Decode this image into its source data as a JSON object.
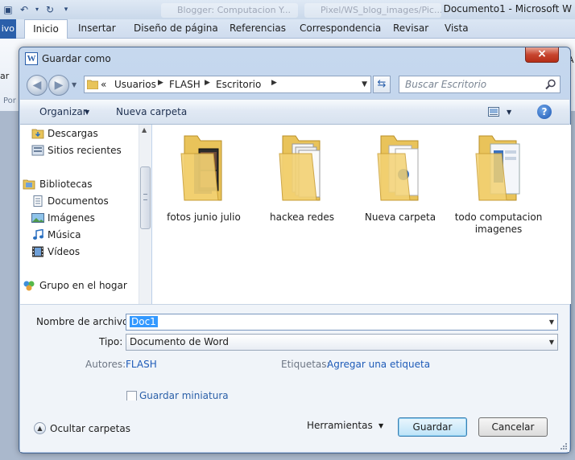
{
  "word": {
    "title": "Documento1 - Microsoft W",
    "browser_tabs": [
      "Blogger: Computacion Y...",
      "Pixel/WS_blog_images/Pic..."
    ],
    "archivo_tab": "ivo",
    "ribbon_tabs": [
      "Inicio",
      "Insertar",
      "Diseño de página",
      "Referencias",
      "Correspondencia",
      "Revisar",
      "Vista"
    ],
    "left_fragments": [
      "ar",
      "Por"
    ],
    "right_fragment": "A"
  },
  "dialog": {
    "title": "Guardar como",
    "close_label": "×",
    "breadcrumb": [
      "Usuarios",
      "FLASH",
      "Escritorio"
    ],
    "breadcrumb_prefix": "«",
    "search_placeholder": "Buscar Escritorio",
    "toolbar": {
      "organizar": "Organizar",
      "nueva_carpeta": "Nueva carpeta",
      "help": "?"
    },
    "nav_items": [
      {
        "label": "Descargas",
        "icon": "downloads-icon"
      },
      {
        "label": "Sitios recientes",
        "icon": "recent-places-icon"
      },
      {
        "label": "Bibliotecas",
        "icon": "libraries-icon"
      },
      {
        "label": "Documentos",
        "icon": "documents-icon"
      },
      {
        "label": "Imágenes",
        "icon": "pictures-icon"
      },
      {
        "label": "Música",
        "icon": "music-icon"
      },
      {
        "label": "Vídeos",
        "icon": "videos-icon"
      },
      {
        "label": "Grupo en el hogar",
        "icon": "homegroup-icon"
      }
    ],
    "folders": [
      {
        "label": "fotos junio julio"
      },
      {
        "label": "hackea redes"
      },
      {
        "label": "Nueva carpeta"
      },
      {
        "label": "todo computacion imagenes"
      }
    ],
    "form": {
      "filename_label": "Nombre de archivo:",
      "filename_value": "Doc1",
      "type_label": "Tipo:",
      "type_value": "Documento de Word",
      "authors_label": "Autores:",
      "authors_value": "FLASH",
      "tags_label": "Etiquetas:",
      "tags_value": "Agregar una etiqueta",
      "thumbnail_label": "Guardar miniatura"
    },
    "footer": {
      "hide_folders": "Ocultar carpetas",
      "tools": "Herramientas",
      "save": "Guardar",
      "cancel": "Cancelar"
    }
  }
}
